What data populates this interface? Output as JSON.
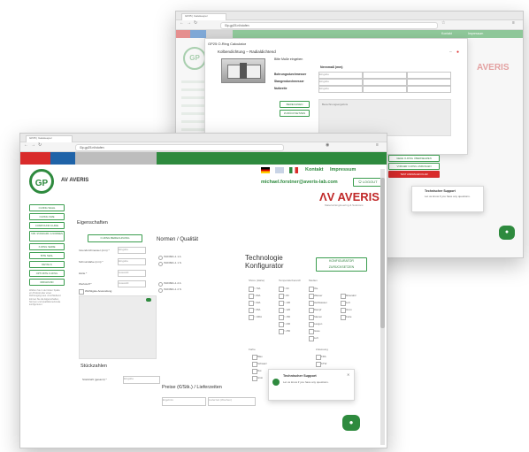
{
  "back_window": {
    "tab_title": "GP25 | Gatekeeper",
    "url": "l3p.gp25.nl/stufen",
    "top_links": [
      "Kontakt",
      "Impressum"
    ],
    "dialog_title": "GP25 O-Ring Calculator",
    "section_title": "Kolbendichtung – Radialdichtend",
    "prompt": "Bitte Maße eingeben",
    "col_header": "Nennmaß (mm)",
    "rows": [
      "Bohrungsdurchmesser",
      "Stangendurchmesser",
      "Nutbreite"
    ],
    "placeholder": "Eingabe",
    "calc_button": "BERECHNEN",
    "reset_button": "ZURÜCKSETZEN",
    "results_label": "Berechnungsergebnis",
    "logo_text": "AVERIS",
    "action_buttons": [
      "GEHE O-RING ÜBERNEHMEN",
      "VORHER O-RING ANFRAGEN"
    ],
    "red_button": "TEST ANFRAGEN KLAR",
    "chat_title": "Technischer Support",
    "chat_text": "Let us know if you have any questions."
  },
  "front_window": {
    "tab_title": "GP25 | Gatekeeper",
    "url": "l3p.gp25.nl/stufen",
    "brand": "AV AVERIS",
    "nav_links": [
      "Kontakt",
      "Impressum"
    ],
    "user_email": "michael.forstner@averis-lab.com",
    "logout": "LOGOUT",
    "logo_big": "AVERIS",
    "logo_sub": "Material Engineering & Solutions",
    "sidebar": [
      "O-RING WAHL",
      "O-RING SIZE",
      "COMPOUND GUIDE",
      "TAB. STANDARD. & NORMEN",
      "X-RING SERIE",
      "BITE SEAL",
      "DETAILS",
      "OPTI-BITE O-RING",
      "IRRGRUND"
    ],
    "sidebar_text": "Wählen Sie in der linken Spalte ein Produkt oder einen Dichtungstyp aus. Anschließend können Sie die Eigenschaften, Normen und Qualitätsmerkmale konfigurieren.",
    "eigenschaften": "Eigenschaften",
    "eigen_btn": "O-RING BERECHNUNG",
    "fields": [
      "Innendurchmesser (mm) *",
      "Schnurstärke (mm) *",
      "Härte *",
      "Werkstoff *"
    ],
    "field_placeholders": [
      "Eingabe",
      "Eingabe",
      "Auswahl",
      "Auswahl"
    ],
    "checkbox_label": "Wichtigste Anwendung",
    "normen": "Normen / Qualität",
    "normen_items": [
      "ISO3601-1 1 A",
      "ISO3601-1 1 S",
      "ISO3601-1 2 A",
      "ISO3601-1 2 S"
    ],
    "tech_title": "Technologie Konfigurator",
    "konfig_btn": "KONFIGURATOR ZURÜCKSETZEN",
    "tech_cols": [
      "Shore (Härte)",
      "Temperaturbereich",
      "Medien"
    ],
    "tech_rows_a": [
      "> 70A",
      "> 80A",
      "> 90A",
      "> 95A",
      "> 100A"
    ],
    "tech_rows_b": [
      "> 60",
      "> 80",
      "> 100",
      "> 120",
      "> 150",
      "> 200",
      "> 250"
    ],
    "tech_rows_c": [
      "Öle",
      "Wasser",
      "Heißwasser",
      "Dampf",
      "Säuren",
      "Laugen",
      "Gase",
      "Luft"
    ],
    "tech_rows_d": [
      "Mineralöl",
      "Luft",
      "Ozon",
      "Fette"
    ],
    "lower_label_a": "Farbe",
    "lower_rows_a": [
      "Blau",
      "Schwarz",
      "Rot",
      "Grün"
    ],
    "lower_label_b": "Zulassung",
    "lower_rows_b": [
      "FDA",
      "KTW",
      "DVGW",
      "WRAS"
    ],
    "stueckzahl": "Stückzahlen",
    "stueck_field": "Stückzahl (gesamt) *",
    "preis": "Preise (€/Stk.) / Lieferzeiten",
    "preis_fields": [
      "Ergebnis",
      "Lieferzeit (Wochen)"
    ],
    "chat_title": "Technischer Support",
    "chat_text": "Let us know if you have any questions."
  },
  "colors": {
    "green": "#2e8a3e",
    "red": "#d92b2b",
    "blue": "#1f63a8",
    "grey": "#bdbdbd",
    "accent_red": "#c02828"
  }
}
